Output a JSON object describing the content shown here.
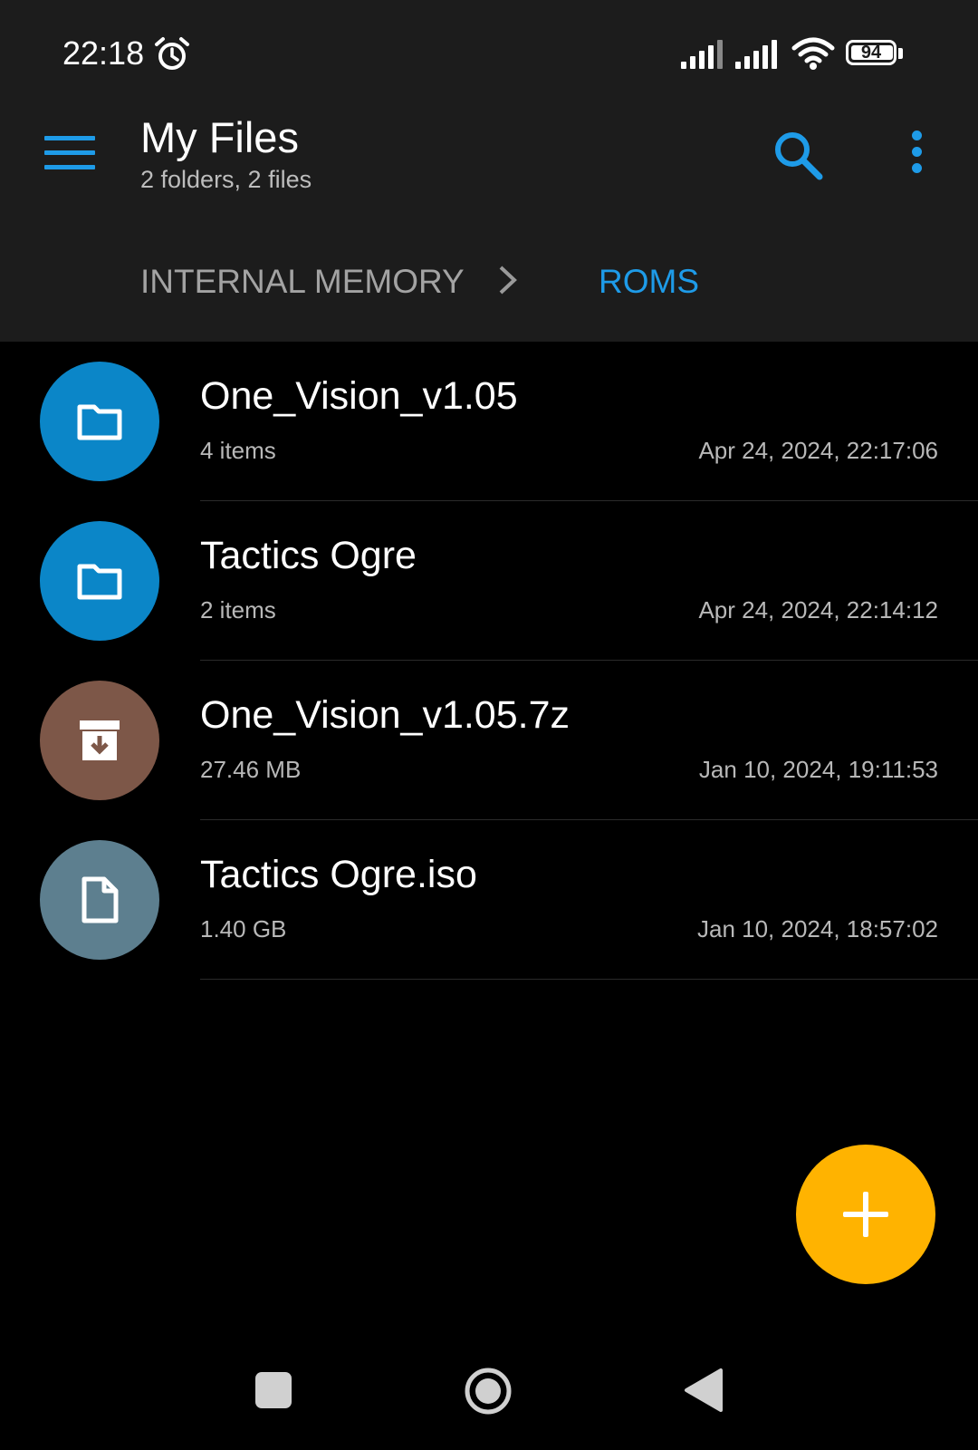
{
  "status_bar": {
    "time": "22:18",
    "battery_level": "94",
    "icons": [
      "alarm-icon",
      "signal-icon",
      "signal-icon",
      "wifi-icon",
      "battery-icon"
    ]
  },
  "toolbar": {
    "title": "My Files",
    "subtitle": "2 folders, 2 files",
    "menu_icon": "hamburger-menu-icon",
    "search_icon": "search-icon",
    "more_icon": "more-vert-icon"
  },
  "breadcrumb": {
    "items": [
      {
        "label": "INTERNAL MEMORY",
        "active": false
      },
      {
        "label": "ROMS",
        "active": true
      }
    ],
    "separator_icon": "chevron-right-icon"
  },
  "files": [
    {
      "name": "One_Vision_v1.05",
      "meta": "4 items",
      "date": "Apr 24, 2024, 22:17:06",
      "type": "folder",
      "icon": "folder-icon",
      "color": "#0b86c8"
    },
    {
      "name": "Tactics Ogre",
      "meta": "2 items",
      "date": "Apr 24, 2024, 22:14:12",
      "type": "folder",
      "icon": "folder-icon",
      "color": "#0b86c8"
    },
    {
      "name": "One_Vision_v1.05.7z",
      "meta": "27.46 MB",
      "date": "Jan 10, 2024, 19:11:53",
      "type": "archive",
      "icon": "archive-icon",
      "color": "#7d5748"
    },
    {
      "name": "Tactics Ogre.iso",
      "meta": "1.40 GB",
      "date": "Jan 10, 2024, 18:57:02",
      "type": "file",
      "icon": "file-icon",
      "color": "#5d7f8f"
    }
  ],
  "fab": {
    "icon": "add-icon",
    "color": "#ffb300"
  },
  "nav_bar": {
    "icons": [
      "recents-icon",
      "home-icon",
      "back-icon"
    ]
  },
  "colors": {
    "accent": "#1e9be8",
    "header_bg": "#1c1c1c",
    "background": "#000000"
  }
}
